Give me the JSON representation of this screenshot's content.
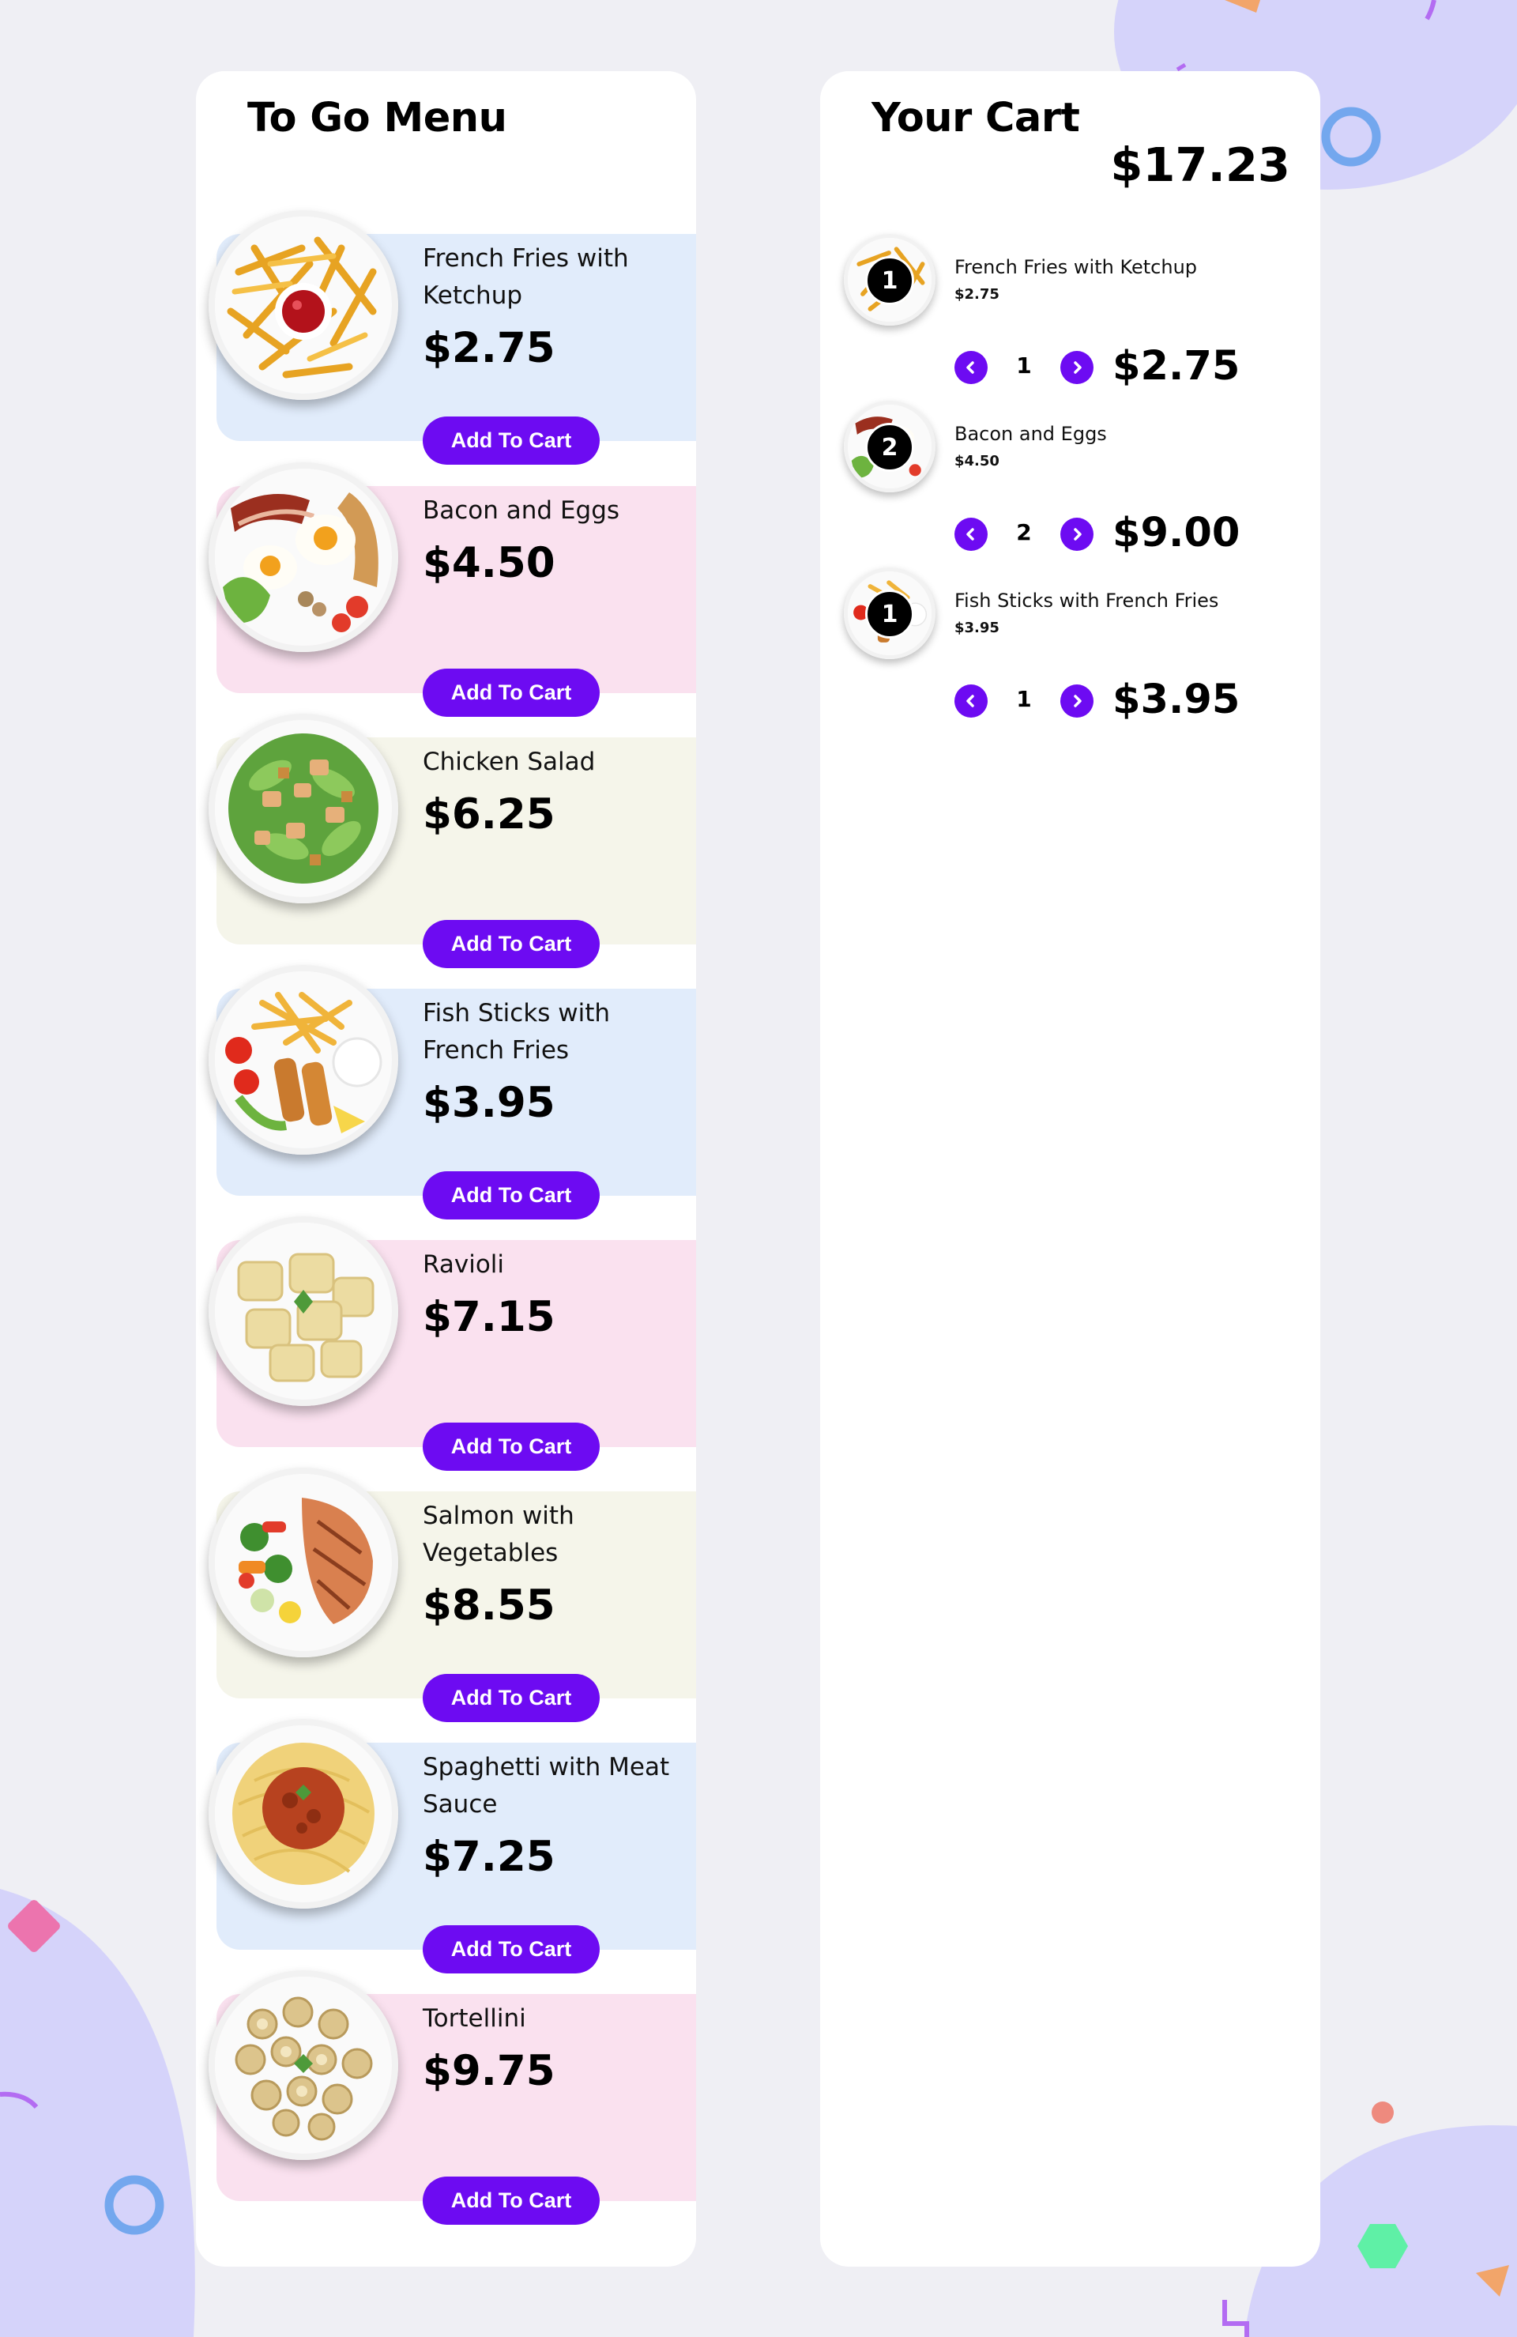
{
  "colors": {
    "background": "#efeff4",
    "panel": "#ffffff",
    "accent": "#6d0bf2",
    "card_blue": "#e1ecfb",
    "card_pink": "#fae1ef",
    "card_cream": "#f5f5ea",
    "blob": "#d5d3fa"
  },
  "menu": {
    "title": "To Go Menu",
    "add_label": "Add To Cart",
    "items": [
      {
        "name": "French Fries with Ketchup",
        "price": "$2.75",
        "bg": "#e1ecfb",
        "icon": "french-fries-plate-icon"
      },
      {
        "name": "Bacon and Eggs",
        "price": "$4.50",
        "bg": "#fae1ef",
        "icon": "bacon-eggs-plate-icon"
      },
      {
        "name": "Chicken Salad",
        "price": "$6.25",
        "bg": "#f5f5ea",
        "icon": "chicken-salad-plate-icon"
      },
      {
        "name": "Fish Sticks with French Fries",
        "price": "$3.95",
        "bg": "#e1ecfb",
        "icon": "fish-sticks-plate-icon"
      },
      {
        "name": "Ravioli",
        "price": "$7.15",
        "bg": "#fae1ef",
        "icon": "ravioli-plate-icon"
      },
      {
        "name": "Salmon with Vegetables",
        "price": "$8.55",
        "bg": "#f5f5ea",
        "icon": "salmon-plate-icon"
      },
      {
        "name": "Spaghetti with Meat Sauce",
        "price": "$7.25",
        "bg": "#e1ecfb",
        "icon": "spaghetti-plate-icon"
      },
      {
        "name": "Tortellini",
        "price": "$9.75",
        "bg": "#fae1ef",
        "icon": "tortellini-plate-icon"
      }
    ]
  },
  "cart": {
    "title": "Your Cart",
    "total": "$17.23",
    "items": [
      {
        "name": "French Fries with Ketchup",
        "unit_price": "$2.75",
        "qty": "1",
        "line_total": "$2.75",
        "icon": "french-fries-thumb-icon"
      },
      {
        "name": "Bacon and Eggs",
        "unit_price": "$4.50",
        "qty": "2",
        "line_total": "$9.00",
        "icon": "bacon-eggs-thumb-icon"
      },
      {
        "name": "Fish Sticks with French Fries",
        "unit_price": "$3.95",
        "qty": "1",
        "line_total": "$3.95",
        "icon": "fish-sticks-thumb-icon"
      }
    ]
  }
}
